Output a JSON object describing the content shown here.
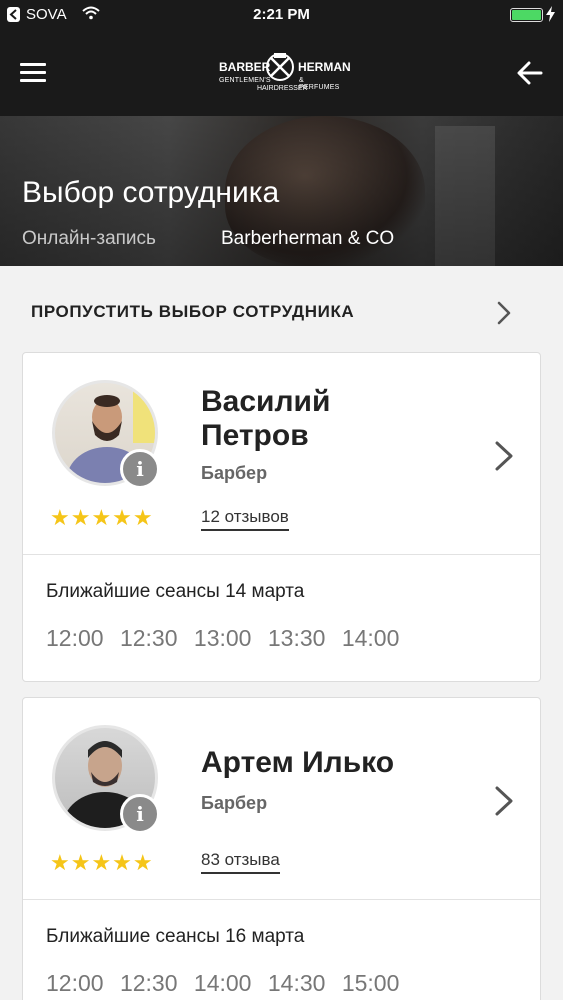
{
  "status_bar": {
    "carrier": "SOVA",
    "time": "2:21 PM"
  },
  "navbar": {
    "logo": {
      "left": "BARBER",
      "right": "HERMAN",
      "sub_left": "GENTLEMEN'S",
      "sub_right": "& PERFUMES",
      "sub_bottom": "HAIRDRESSER"
    }
  },
  "hero": {
    "title": "Выбор сотрудника",
    "subtitle_left": "Онлайн-запись",
    "subtitle_right": "Barberherman & CO"
  },
  "skip": {
    "label": "ПРОПУСТИТЬ ВЫБОР СОТРУДНИКА"
  },
  "employees": [
    {
      "name_line1": "Василий",
      "name_line2": "Петров",
      "role": "Барбер",
      "reviews": "12 отзывов",
      "rating": 5,
      "slots_title": "Ближайшие сеансы 14 марта",
      "slots": [
        "12:00",
        "12:30",
        "13:00",
        "13:30",
        "14:00"
      ]
    },
    {
      "name": "Артем Илько",
      "role": "Барбер",
      "reviews": "83 отзыва",
      "rating": 5,
      "slots_title": "Ближайшие сеансы 16 марта",
      "slots": [
        "12:00",
        "12:30",
        "14:00",
        "14:30",
        "15:00"
      ]
    }
  ],
  "colors": {
    "header": "#1a1a1a",
    "star": "#f5c518",
    "battery": "#4cd964",
    "info_badge": "#8a8a8a"
  },
  "icons": {
    "menu": "hamburger-icon",
    "back": "arrow-left-icon",
    "chevron": "chevron-right-icon",
    "info": "info-icon",
    "star": "star-icon"
  }
}
